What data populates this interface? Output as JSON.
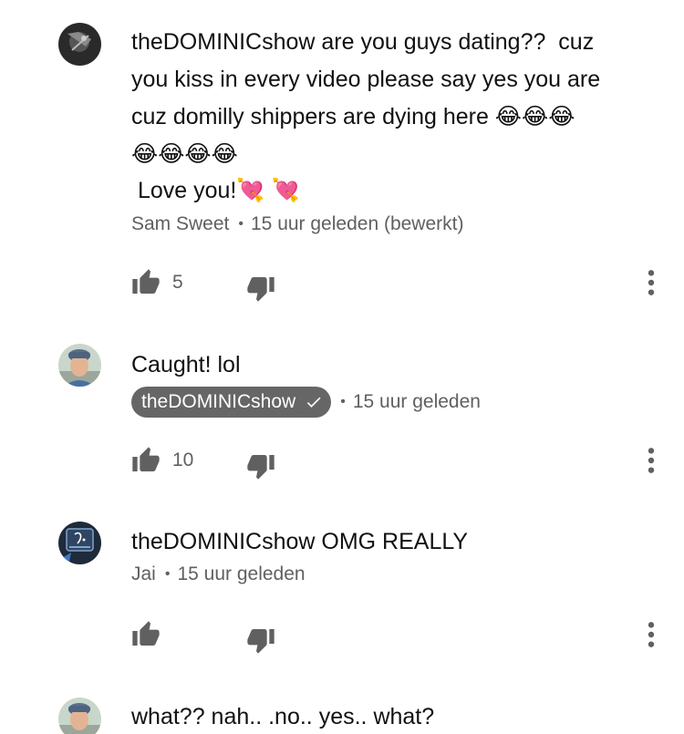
{
  "comments": [
    {
      "text_lines": [
        "theDOMINICshow are you guys dating??  cuz",
        "you kiss in every video please say yes you are",
        "cuz domilly shippers are dying here 😂😂😂",
        "😂😂😂😂",
        " Love you!💘 💘"
      ],
      "author": "Sam Sweet",
      "time": "15 uur geleden (bewerkt)",
      "like_count": "5"
    },
    {
      "text_lines": [
        "Caught! lol"
      ],
      "author": "theDOMINICshow",
      "author_is_owner": true,
      "time": "15 uur geleden",
      "like_count": "10"
    },
    {
      "text_lines": [
        "theDOMINICshow OMG REALLY"
      ],
      "author": "Jai",
      "time": "15 uur geleden",
      "like_count": ""
    },
    {
      "text_lines": [
        "what?? nah.. .no.. yes.. what?"
      ]
    }
  ],
  "separator": "•",
  "colors": {
    "meta_text": "#606060",
    "owner_badge_bg": "#666666",
    "icon": "#606060"
  },
  "icons": {
    "like": "thumbs-up-icon",
    "dislike": "thumbs-down-icon",
    "more": "more-vertical-icon",
    "verified": "check-icon"
  }
}
